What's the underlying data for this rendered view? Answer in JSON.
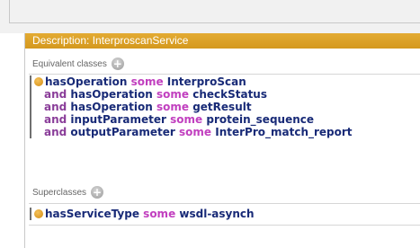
{
  "panel": {
    "title": "Description: InterproscanService",
    "accent_color": "#d9a02a"
  },
  "equivalent": {
    "label": "Equivalent classes",
    "add_icon": "plus-circle-icon",
    "expression": [
      {
        "prefix": "",
        "property": "hasOperation",
        "keyword": "some",
        "filler": "InterproScan"
      },
      {
        "prefix": "and",
        "property": "hasOperation",
        "keyword": "some",
        "filler": "checkStatus"
      },
      {
        "prefix": "and",
        "property": "hasOperation",
        "keyword": "some",
        "filler": "getResult"
      },
      {
        "prefix": "and",
        "property": "inputParameter",
        "keyword": "some",
        "filler": "protein_sequence"
      },
      {
        "prefix": "and",
        "property": "outputParameter",
        "keyword": "some",
        "filler": "InterPro_match_report"
      }
    ]
  },
  "superclasses": {
    "label": "Superclasses",
    "add_icon": "plus-circle-icon",
    "expression": [
      {
        "prefix": "",
        "property": "hasServiceType",
        "keyword": "some",
        "filler": "wsdl-asynch"
      }
    ]
  }
}
